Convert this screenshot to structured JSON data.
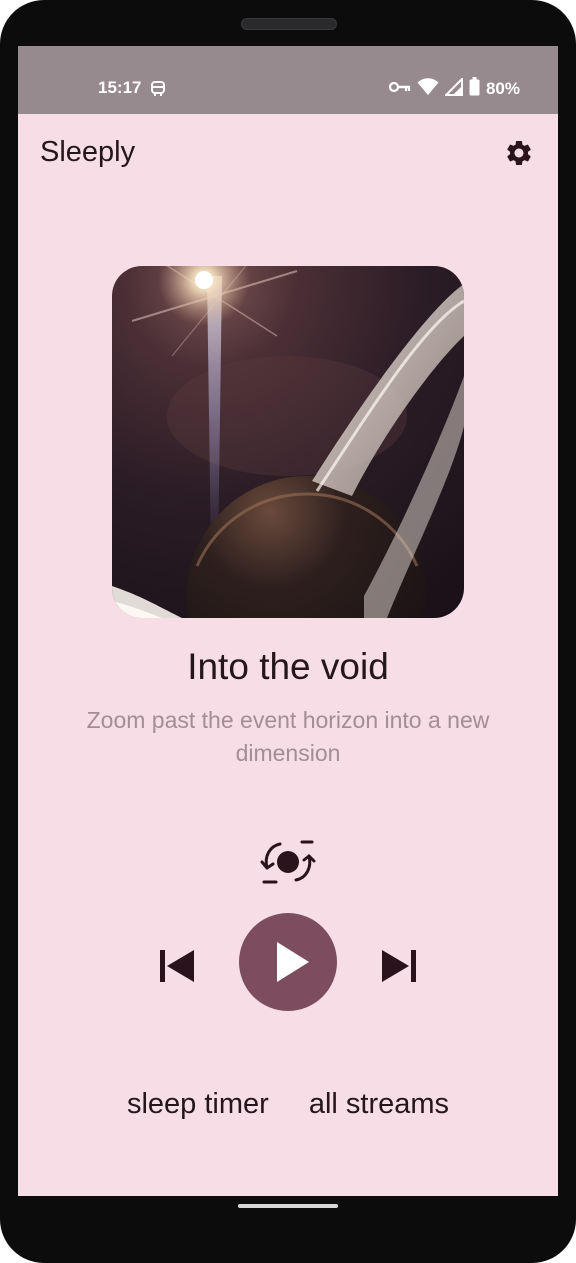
{
  "status_bar": {
    "time": "15:17",
    "battery_percent": "80%",
    "icons": [
      "android-robot-icon",
      "vpn-key-icon",
      "wifi-icon",
      "cell-signal-icon",
      "battery-icon"
    ]
  },
  "app_bar": {
    "title": "Sleeply",
    "settings_icon": "gear-icon"
  },
  "now_playing": {
    "title": "Into the void",
    "description": "Zoom past the event horizon into a new dimension",
    "artwork": "ringed-planet-artwork"
  },
  "controls": {
    "loop_icon": "loop-icon",
    "previous_icon": "skip-previous-icon",
    "play_icon": "play-icon",
    "next_icon": "skip-next-icon"
  },
  "bottom_actions": {
    "sleep_timer": "sleep timer",
    "all_streams": "all streams"
  },
  "colors": {
    "background": "#f6dde6",
    "status_bar": "#978a8e",
    "accent": "#7c4d5e",
    "text_primary": "#25161c",
    "text_secondary": "#a38e96"
  }
}
